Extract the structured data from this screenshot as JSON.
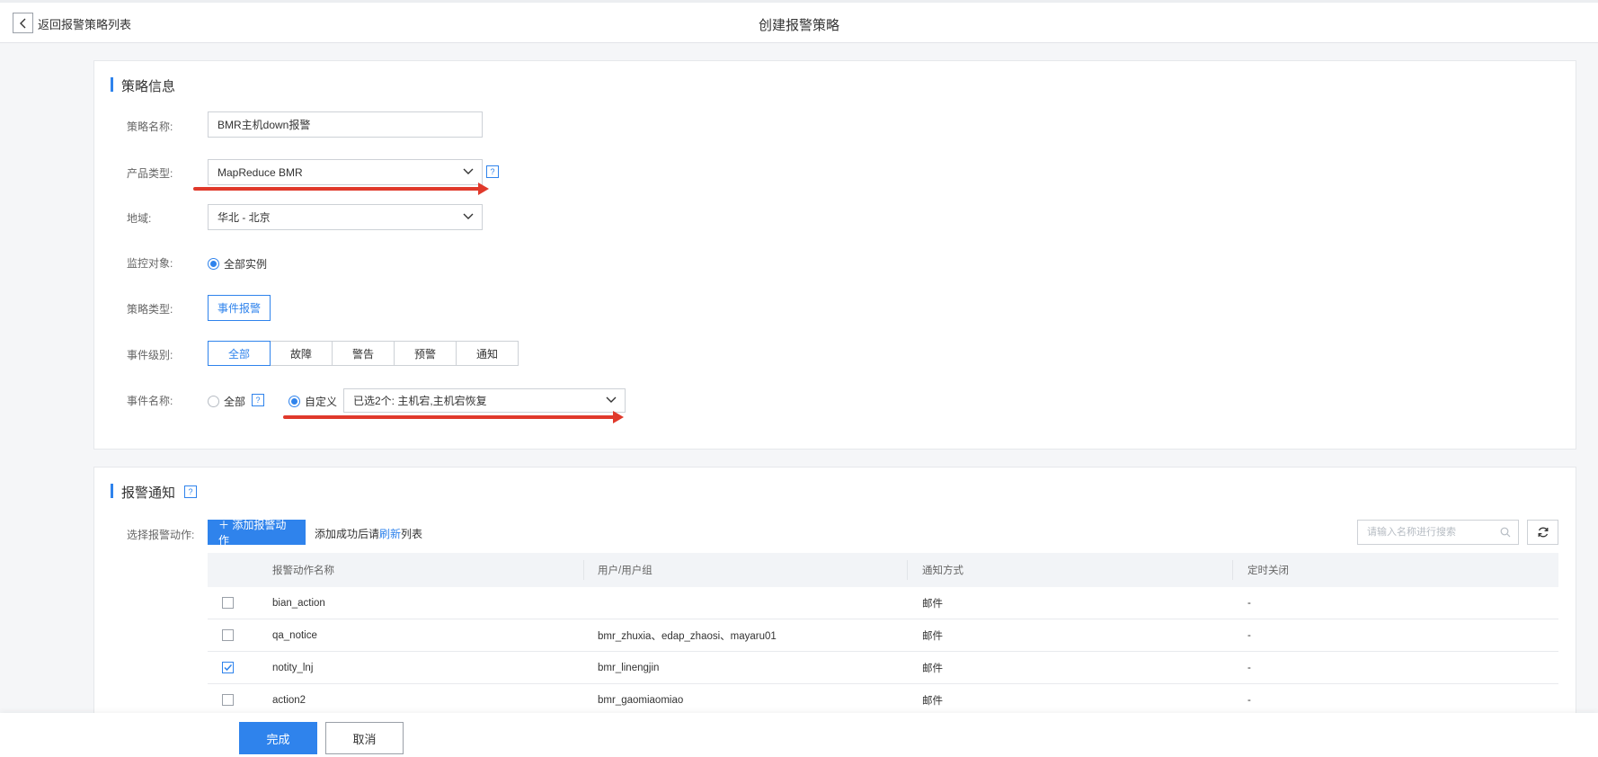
{
  "header": {
    "back_label": "返回报警策略列表",
    "title": "创建报警策略"
  },
  "policy_info": {
    "section_title": "策略信息",
    "name_label": "策略名称:",
    "name_value": "BMR主机down报警",
    "product_label": "产品类型:",
    "product_value": "MapReduce BMR",
    "region_label": "地域:",
    "region_value": "华北 - 北京",
    "target_label": "监控对象:",
    "target_option": "全部实例",
    "type_label": "策略类型:",
    "type_value": "事件报警",
    "level_label": "事件级别:",
    "levels": [
      "全部",
      "故障",
      "警告",
      "预警",
      "通知"
    ],
    "event_name_label": "事件名称:",
    "event_all_option": "全部",
    "event_custom_option": "自定义",
    "event_selected": "已选2个:  主机宕,主机宕恢复",
    "help_glyph": "?"
  },
  "notify": {
    "section_title": "报警通知",
    "action_label": "选择报警动作:",
    "add_button": "＋  添加报警动作",
    "hint_before": "添加成功后请",
    "hint_link": "刷新",
    "hint_after": "列表",
    "search_placeholder": "请输入名称进行搜索",
    "columns": [
      "报警动作名称",
      "用户/用户组",
      "通知方式",
      "定时关闭"
    ],
    "rows": [
      {
        "name": "bian_action",
        "users": "",
        "method": "邮件",
        "timer": "-",
        "checked": false
      },
      {
        "name": "qa_notice",
        "users": "bmr_zhuxia、edap_zhaosi、mayaru01",
        "method": "邮件",
        "timer": "-",
        "checked": false
      },
      {
        "name": "notity_lnj",
        "users": "bmr_linengjin",
        "method": "邮件",
        "timer": "-",
        "checked": true
      },
      {
        "name": "action2",
        "users": "bmr_gaomiaomiao",
        "method": "邮件",
        "timer": "-",
        "checked": false
      }
    ]
  },
  "footer": {
    "done": "完成",
    "cancel": "取消"
  },
  "colors": {
    "accent": "#2f83ec",
    "annotation_red": "#e0392b"
  }
}
